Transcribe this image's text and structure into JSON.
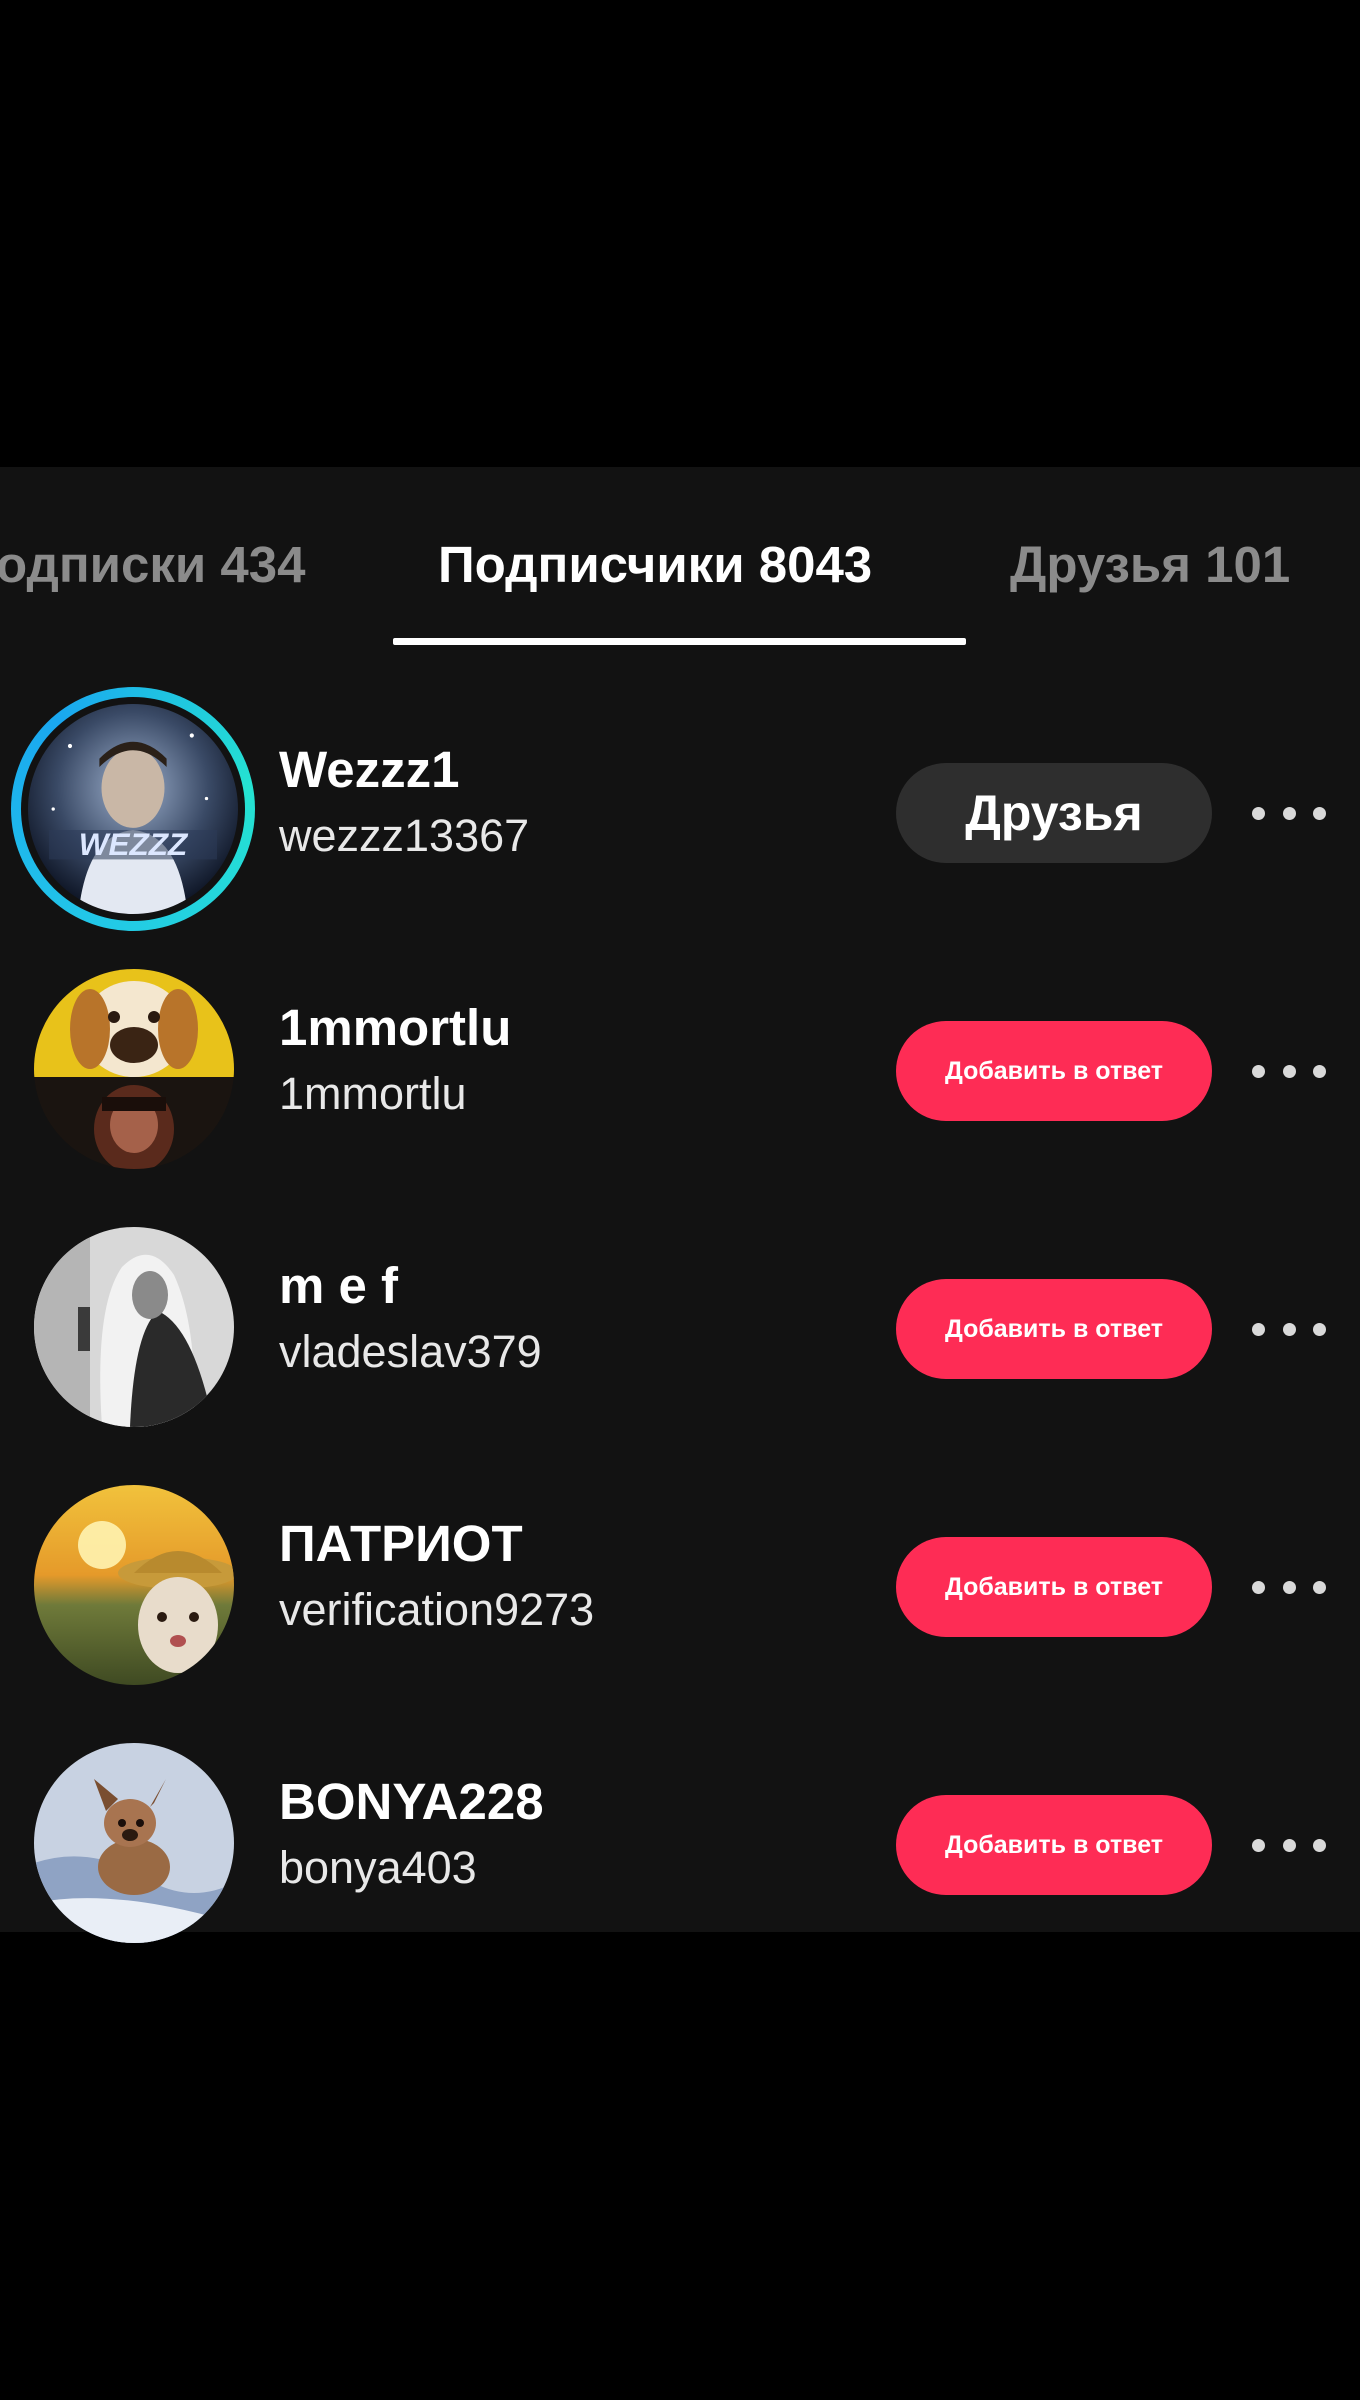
{
  "tabs": {
    "following": "одписки 434",
    "followers": "Подписчики 8043",
    "friends": "Друзья 101"
  },
  "colors": {
    "background": "#121212",
    "accent_button": "#fe2c55",
    "friends_button": "#2e2e2e",
    "story_ring": "#22c7e8"
  },
  "users": [
    {
      "name": "Wezzz1",
      "username": "wezzz13367",
      "button": "Друзья",
      "button_type": "friends",
      "has_story_ring": true,
      "avatar_text": "WEZZZ"
    },
    {
      "name": "1mmortlu",
      "username": "1mmortlu",
      "button": "Добавить в ответ",
      "button_type": "add"
    },
    {
      "name": "m e f",
      "username": "vladeslav379",
      "button": "Добавить в ответ",
      "button_type": "add"
    },
    {
      "name": "ПАТРИОТ",
      "username": "verification9273",
      "button": "Добавить в ответ",
      "button_type": "add"
    },
    {
      "name": "BONYA228",
      "username": "bonya403",
      "button": "Добавить в ответ",
      "button_type": "add"
    }
  ],
  "icons": {
    "more": "more-horizontal-icon"
  }
}
